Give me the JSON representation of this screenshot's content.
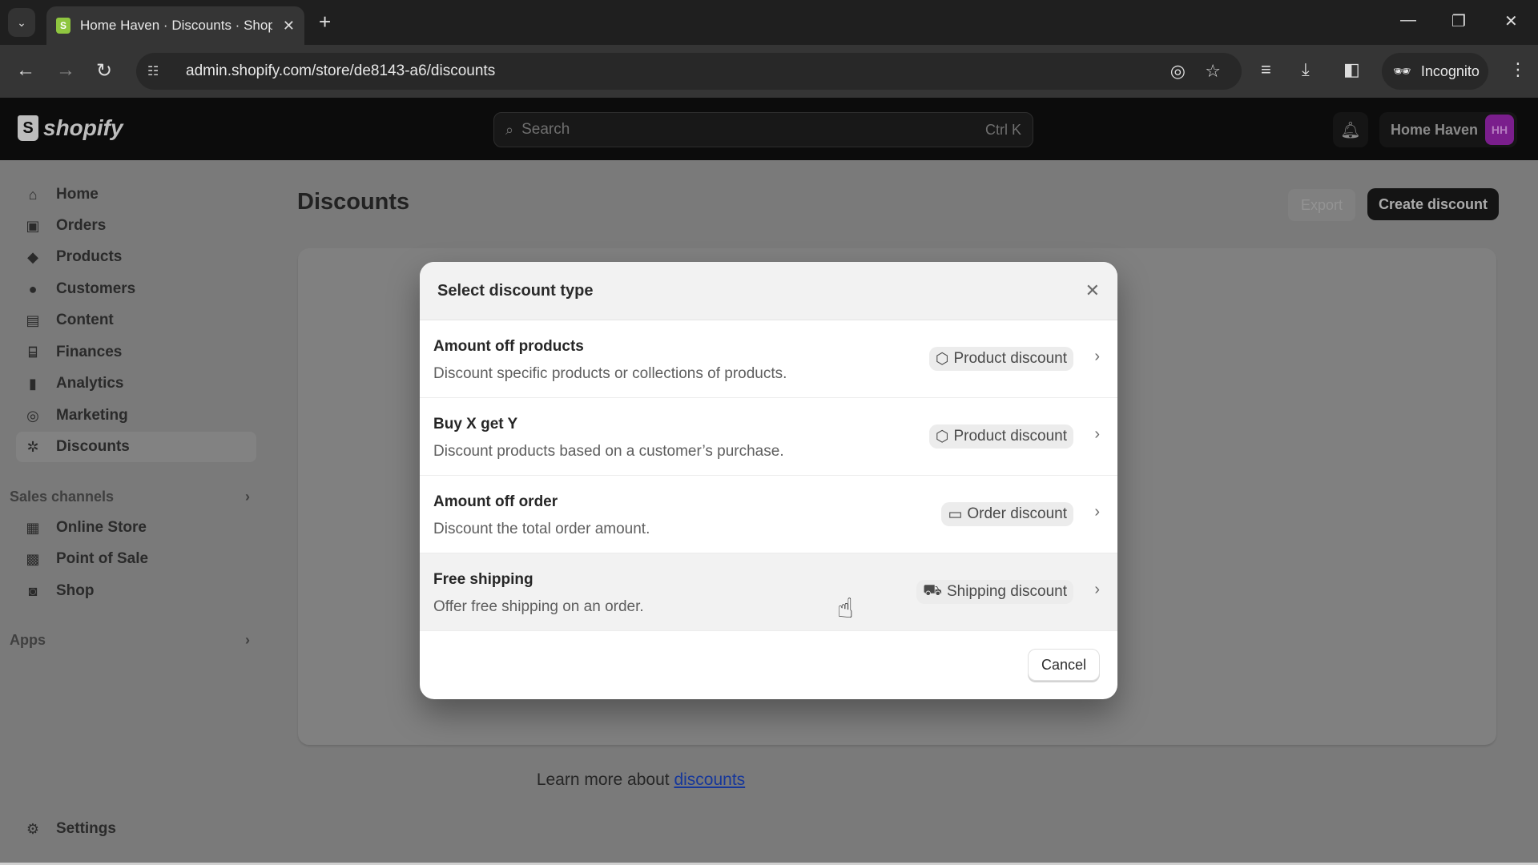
{
  "browser": {
    "tab_title": "Home Haven · Discounts · Shopify",
    "url": "admin.shopify.com/store/de8143-a6/discounts",
    "incognito_label": "Incognito"
  },
  "header": {
    "logo_text": "shopify",
    "search_placeholder": "Search",
    "search_shortcut": "Ctrl K",
    "store_name": "Home Haven",
    "avatar_initials": "HH",
    "avatar_color": "#7a1e8c"
  },
  "sidebar": {
    "items": [
      {
        "label": "Home",
        "icon": "home-icon"
      },
      {
        "label": "Orders",
        "icon": "orders-icon"
      },
      {
        "label": "Products",
        "icon": "tag-icon"
      },
      {
        "label": "Customers",
        "icon": "person-icon"
      },
      {
        "label": "Content",
        "icon": "content-icon"
      },
      {
        "label": "Finances",
        "icon": "bank-icon"
      },
      {
        "label": "Analytics",
        "icon": "bar-chart-icon"
      },
      {
        "label": "Marketing",
        "icon": "target-icon"
      },
      {
        "label": "Discounts",
        "icon": "discount-icon",
        "active": true
      }
    ],
    "sales_channels_label": "Sales channels",
    "sales_channels": [
      {
        "label": "Online Store",
        "icon": "store-icon"
      },
      {
        "label": "Point of Sale",
        "icon": "pos-icon"
      },
      {
        "label": "Shop",
        "icon": "shop-icon"
      }
    ],
    "apps_label": "Apps",
    "settings_label": "Settings"
  },
  "page": {
    "title": "Discounts",
    "export_label": "Export",
    "create_label": "Create discount",
    "learn_more_prefix": "Learn more about ",
    "learn_more_link": "discounts"
  },
  "modal": {
    "title": "Select discount type",
    "options": [
      {
        "title": "Amount off products",
        "description": "Discount specific products or collections of products.",
        "badge": "Product discount",
        "badge_icon": "tag-icon"
      },
      {
        "title": "Buy X get Y",
        "description": "Discount products based on a customer’s purchase.",
        "badge": "Product discount",
        "badge_icon": "tag-icon"
      },
      {
        "title": "Amount off order",
        "description": "Discount the total order amount.",
        "badge": "Order discount",
        "badge_icon": "order-icon"
      },
      {
        "title": "Free shipping",
        "description": "Offer free shipping on an order.",
        "badge": "Shipping discount",
        "badge_icon": "truck-icon",
        "hovered": true
      }
    ],
    "cancel_label": "Cancel"
  }
}
